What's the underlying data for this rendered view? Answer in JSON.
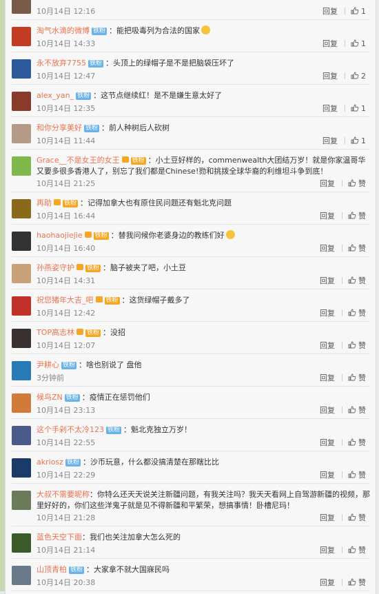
{
  "labels": {
    "reply": "回复",
    "like": "赞"
  },
  "colors": {
    "username": "#eb7350",
    "iron_badge": "#6bb3e6",
    "vip_badge": "#f6a623"
  },
  "comments": [
    {
      "user": "",
      "badge": "",
      "text": "",
      "time": "10月14日 12:16",
      "likes": "1",
      "avatar": "#7a5a4a"
    },
    {
      "user": "淘气水滴的微博",
      "badge": "铁粉",
      "text": "：能把吸毒列为合法的国家",
      "emoji": true,
      "time": "10月14日 14:33",
      "likes": "1",
      "avatar": "#c23b22"
    },
    {
      "user": "永不放弃7755",
      "badge": "铁粉",
      "text": "：头顶上的绿帽子是不是把脑袋压坏了",
      "time": "10月14日 12:47",
      "likes": "2",
      "avatar": "#2d5a9c"
    },
    {
      "user": "alex_yan_",
      "badge": "铁粉",
      "text": "：这节点继续红！是不是嫌生意太好了",
      "time": "10月14日 12:35",
      "likes": "1",
      "avatar": "#8a3a2a"
    },
    {
      "user": "和你分享美好",
      "badge": "铁粉",
      "text": "：前人种树后人砍树",
      "time": "10月14日 11:44",
      "likes": "1",
      "avatar": "#b59a88"
    },
    {
      "user": "Grace__不是女王的女王",
      "badge": "铁粉",
      "vip": true,
      "text": "：小土豆好样的，commenwealth大团结万岁！就是你家温哥华又要多很多香港人了，别忘了我们都是Chinese!勠和挑拨全球华裔的利维坦斗争到底！",
      "time": "10月14日 21:25",
      "likes": "赞",
      "avatar": "#7fb84a",
      "tall": true
    },
    {
      "user": "再助",
      "badge": "铁粉",
      "vip": true,
      "text": "：记得加拿大也有原住民问题还有魁北克问题",
      "time": "10月14日 16:44",
      "likes": "赞",
      "avatar": "#8a6a1a"
    },
    {
      "user": "haohaojiejie",
      "badge": "铁粉",
      "vip": true,
      "text": "：替我问候你老婆身边的教练们好",
      "emoji": true,
      "time": "10月14日 16:40",
      "likes": "赞",
      "avatar": "#333333"
    },
    {
      "user": "孙燕姿守护",
      "badge": "铁粉",
      "vip": true,
      "text": "：脑子被夹了吧，小土豆",
      "time": "10月14日 14:31",
      "likes": "赞",
      "avatar": "#c9a27a"
    },
    {
      "user": "祝您猪年大吉_吧",
      "badge": "铁粉",
      "vip": true,
      "text": "：这货绿帽子戴多了",
      "time": "10月14日 12:42",
      "likes": "赞",
      "avatar": "#c2302a"
    },
    {
      "user": "TOP高志林",
      "badge": "铁粉",
      "vip": true,
      "text": "：没招",
      "time": "10月14日 12:07",
      "likes": "赞",
      "avatar": "#3a3030"
    },
    {
      "user": "尹耕心",
      "badge": "铁粉",
      "text": "：啥也别说了 盘他",
      "time": "3分钟前",
      "likes": "赞",
      "avatar": "#2a7ab8"
    },
    {
      "user": "候鸟ZN",
      "badge": "铁粉",
      "text": "：疫情正在惩罚他们",
      "time": "10月14日 23:13",
      "likes": "赞",
      "avatar": "#d27a3a"
    },
    {
      "user": "这个手剁不太冷123",
      "badge": "铁粉",
      "text": "：魁北克独立万岁！",
      "time": "10月14日 22:55",
      "likes": "赞",
      "avatar": "#4a5a8a"
    },
    {
      "user": "akriosz",
      "badge": "铁粉",
      "text": "：沙币玩意，什么都没搞清楚在那瞎比比",
      "time": "10月14日 22:29",
      "likes": "赞",
      "avatar": "#1a3a6a"
    },
    {
      "user": "大叔不需要昵称",
      "badge": "",
      "text": "：你特么还天天说关注新疆问题，有我关注吗？我天天看网上自驾游新疆的视频，那里好好的，你们这些洋鬼子就是见不得新疆和平繁荣，想搞事情！卧槽尼玛！",
      "time": "10月14日 21:28",
      "likes": "赞",
      "avatar": "#6a7a5a",
      "tall": true
    },
    {
      "user": "蓝色天空下面",
      "badge": "",
      "text": "：我们也关注加拿大怎么死的",
      "time": "10月14日 21:14",
      "likes": "赞",
      "avatar": "#3a5a2a"
    },
    {
      "user": "山顶青柏",
      "badge": "铁粉",
      "text": "：大家拿不就大国寐民吗",
      "time": "10月14日 20:38",
      "likes": "赞",
      "avatar": "#6a7a8a"
    }
  ]
}
